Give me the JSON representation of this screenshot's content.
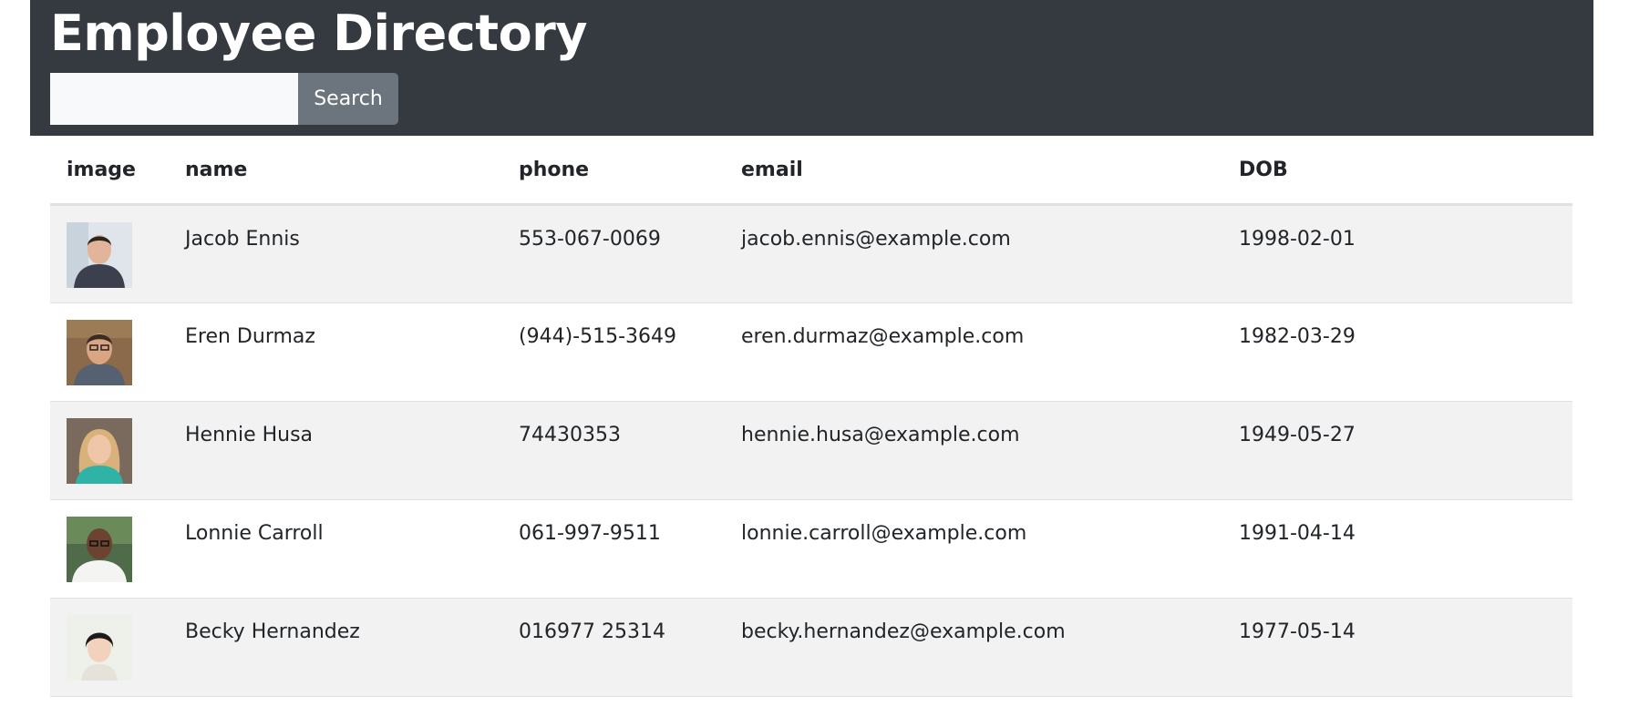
{
  "header": {
    "title": "Employee Directory",
    "search_placeholder": "",
    "search_value": "",
    "search_label": "Search"
  },
  "table": {
    "columns": [
      "image",
      "name",
      "phone",
      "email",
      "DOB"
    ],
    "rows": [
      {
        "name": "Jacob Ennis",
        "phone": "553-067-0069",
        "email": "jacob.ennis@example.com",
        "dob": "1998-02-01",
        "avatar": "male-portrait"
      },
      {
        "name": "Eren Durmaz",
        "phone": "(944)-515-3649",
        "email": "eren.durmaz@example.com",
        "dob": "1982-03-29",
        "avatar": "male-portrait"
      },
      {
        "name": "Hennie Husa",
        "phone": "74430353",
        "email": "hennie.husa@example.com",
        "dob": "1949-05-27",
        "avatar": "female-portrait"
      },
      {
        "name": "Lonnie Carroll",
        "phone": "061-997-9511",
        "email": "lonnie.carroll@example.com",
        "dob": "1991-04-14",
        "avatar": "male-portrait"
      },
      {
        "name": "Becky Hernandez",
        "phone": "016977 25314",
        "email": "becky.hernandez@example.com",
        "dob": "1977-05-14",
        "avatar": "female-portrait"
      }
    ]
  },
  "colors": {
    "header_bg": "#343a40",
    "button_bg": "#6c757d",
    "striped_row_bg": "#f2f2f2"
  }
}
